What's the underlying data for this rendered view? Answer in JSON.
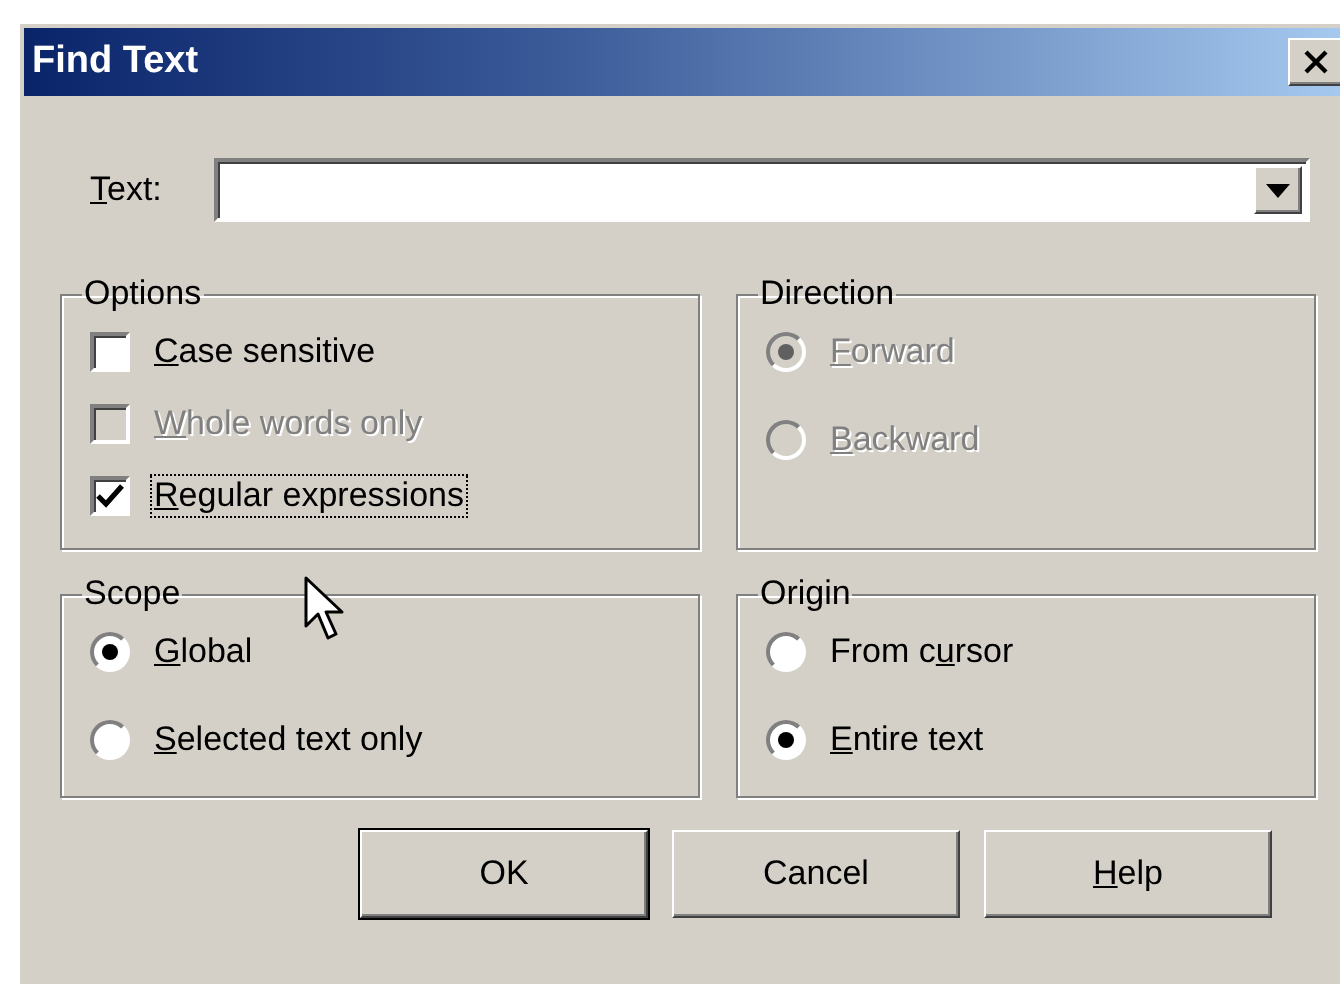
{
  "window": {
    "title": "Find Text"
  },
  "text_field": {
    "label": {
      "key": "T",
      "post": "ext:"
    }
  },
  "groups": [
    {
      "title": "Options",
      "kind": "checkbox",
      "items": [
        {
          "label": {
            "key": "C",
            "post": "ase sensitive"
          },
          "checked": false,
          "disabled": false,
          "focused": false
        },
        {
          "label": {
            "key": "W",
            "post": "hole words only"
          },
          "checked": false,
          "disabled": true,
          "focused": false
        },
        {
          "label": {
            "key": "R",
            "post": "egular expressions"
          },
          "checked": true,
          "disabled": false,
          "focused": true
        }
      ]
    },
    {
      "title": "Direction",
      "kind": "radio",
      "items": [
        {
          "label": {
            "key": "F",
            "post": "orward"
          },
          "selected": true,
          "disabled": true
        },
        {
          "label": {
            "key": "B",
            "post": "ackward"
          },
          "selected": false,
          "disabled": true
        }
      ]
    },
    {
      "title": "Scope",
      "kind": "radio",
      "items": [
        {
          "label": {
            "key": "G",
            "post": "lobal"
          },
          "selected": true,
          "disabled": false
        },
        {
          "label": {
            "key": "S",
            "post": "elected text only"
          },
          "selected": false,
          "disabled": false
        }
      ]
    },
    {
      "title": "Origin",
      "kind": "radio",
      "items": [
        {
          "label": {
            "pre": "From c",
            "key": "u",
            "post": "rsor"
          },
          "selected": false,
          "disabled": false
        },
        {
          "label": {
            "key": "E",
            "post": "ntire text"
          },
          "selected": true,
          "disabled": false
        }
      ]
    }
  ],
  "buttons": [
    {
      "label": {
        "post": "OK"
      },
      "default": true
    },
    {
      "label": {
        "post": "Cancel"
      },
      "default": false
    },
    {
      "label": {
        "key": "H",
        "post": "elp"
      },
      "default": false
    }
  ]
}
